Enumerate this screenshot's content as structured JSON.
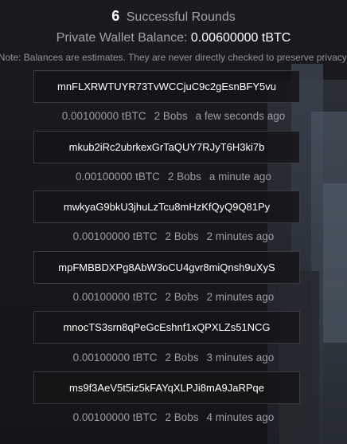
{
  "header": {
    "count": "6",
    "count_label": "Successful Rounds",
    "balance_label": "Private Wallet Balance:",
    "balance_value": "0.00600000 tBTC",
    "note": "Note: Balances are estimates. They are never directly checked to preserve privacy."
  },
  "rounds": [
    {
      "address": "mnFLXRWTUYR73TvWCCjuC9c2gEsnBFY5vu",
      "amount": "0.00100000 tBTC",
      "bobs": "2 Bobs",
      "time": "a few seconds ago"
    },
    {
      "address": "mkub2iRc2ubrkexGrTaQUY7RJyT6H3ki7b",
      "amount": "0.00100000 tBTC",
      "bobs": "2 Bobs",
      "time": "a minute ago"
    },
    {
      "address": "mwkyaG9bkU3jhuLzTcu8mHzKfQyQ9Q81Py",
      "amount": "0.00100000 tBTC",
      "bobs": "2 Bobs",
      "time": "2 minutes ago"
    },
    {
      "address": "mpFMBBDXPg8AbW3oCU4gvr8miQnsh9uXyS",
      "amount": "0.00100000 tBTC",
      "bobs": "2 Bobs",
      "time": "2 minutes ago"
    },
    {
      "address": "mnocTS3srn8qPeGcEshnf1xQPXLZs51NCG",
      "amount": "0.00100000 tBTC",
      "bobs": "2 Bobs",
      "time": "3 minutes ago"
    },
    {
      "address": "ms9f3AeV5t5iz5kFAYqXLPJi8mA9JaRPqe",
      "amount": "0.00100000 tBTC",
      "bobs": "2 Bobs",
      "time": "4 minutes ago"
    }
  ],
  "colors": {
    "background": "#191a1e",
    "text_primary": "#ffffff",
    "text_muted": "#9a9da1",
    "border": "#3a3c40"
  }
}
